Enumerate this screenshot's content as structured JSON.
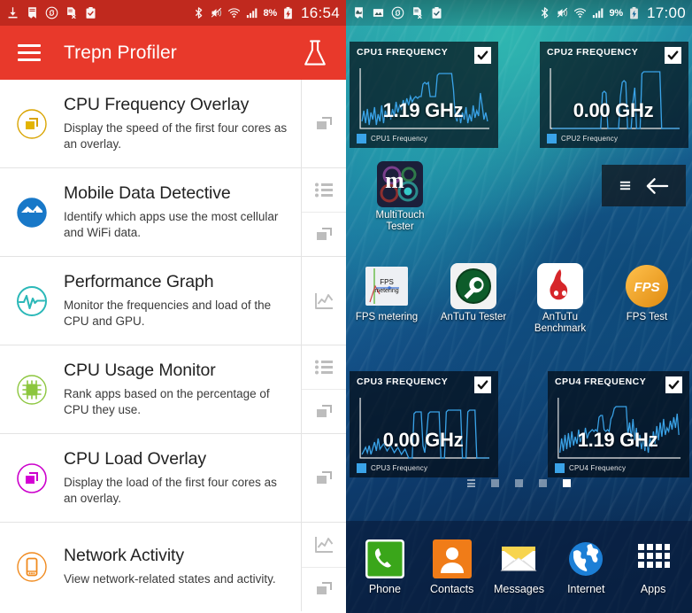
{
  "left_panel": {
    "status_bar": {
      "left_icons": [
        "download-icon",
        "notes-icon",
        "shazam-icon",
        "document-x-icon",
        "clipboard-check-icon"
      ],
      "right_icons": [
        "bluetooth-icon",
        "vibrate-mute-icon",
        "wifi-icon",
        "signal-bars-icon"
      ],
      "battery_percent": "8%",
      "battery_state": "charging",
      "clock": "16:54"
    },
    "appbar": {
      "menu_icon": "hamburger-icon",
      "title": "Trepn Profiler",
      "action_icon": "flask-icon"
    },
    "items": [
      {
        "title": "CPU Frequency Overlay",
        "description": "Display the speed of the first four cores as an overlay.",
        "icon": "overlay-window-icon",
        "icon_color": "#d9a400",
        "actions": [
          "overlay-action-icon"
        ]
      },
      {
        "title": "Mobile Data Detective",
        "description": "Identify which apps use the most cellular and WiFi data.",
        "icon": "data-chart-icon",
        "icon_color": "#1878c8",
        "actions": [
          "list-action-icon",
          "overlay-action-icon"
        ]
      },
      {
        "title": "Performance Graph",
        "description": "Monitor the frequencies and load of the CPU and GPU.",
        "icon": "pulse-icon",
        "icon_color": "#2bb8b8",
        "actions": [
          "graph-action-icon"
        ]
      },
      {
        "title": "CPU Usage Monitor",
        "description": "Rank apps based on the percentage of CPU they use.",
        "icon": "cpu-chip-icon",
        "icon_color": "#8cc63e",
        "actions": [
          "list-action-icon",
          "overlay-action-icon"
        ]
      },
      {
        "title": "CPU Load Overlay",
        "description": "Display the load of the first four cores as an overlay.",
        "icon": "overlay-window-icon",
        "icon_color": "#cc00cc",
        "actions": [
          "overlay-action-icon"
        ]
      },
      {
        "title": "Network Activity",
        "description": "View network-related states and activity.",
        "icon": "phone-network-icon",
        "icon_color": "#f08a1e",
        "actions": [
          "graph-action-icon",
          "overlay-action-icon"
        ]
      }
    ]
  },
  "right_panel": {
    "status_bar": {
      "left_icons": [
        "notes-icon",
        "image-icon",
        "shazam-icon",
        "document-x-icon",
        "clipboard-check-icon"
      ],
      "right_icons": [
        "bluetooth-icon",
        "vibrate-mute-icon",
        "wifi-icon",
        "signal-bars-icon"
      ],
      "battery_percent": "9%",
      "battery_state": "charging",
      "clock": "17:00"
    },
    "widgets": [
      {
        "title": "CPU1 FREQUENCY",
        "value": "1.19 GHz",
        "legend": "CPU1 Frequency",
        "checked": true,
        "series_color": "#3aa3e8"
      },
      {
        "title": "CPU2 FREQUENCY",
        "value": "0.00 GHz",
        "legend": "CPU2 Frequency",
        "checked": true,
        "series_color": "#3aa3e8"
      },
      {
        "title": "CPU3 FREQUENCY",
        "value": "0.00 GHz",
        "legend": "CPU3 Frequency",
        "checked": true,
        "series_color": "#3aa3e8"
      },
      {
        "title": "CPU4 FREQUENCY",
        "value": "1.19 GHz",
        "legend": "CPU4 Frequency",
        "checked": true,
        "series_color": "#3aa3e8"
      }
    ],
    "nav_overlay": {
      "menu_icon": "menu-lines-icon",
      "back_icon": "back-arrow-icon"
    },
    "app_icons": [
      {
        "label": "MultiTouch Tester",
        "icon": "multitouch-tester-icon"
      },
      {
        "label": "FPS metering",
        "icon": "fps-metering-icon"
      },
      {
        "label": "AnTuTu Tester",
        "icon": "antutu-tester-icon"
      },
      {
        "label": "AnTuTu Benchmark",
        "icon": "antutu-benchmark-icon"
      },
      {
        "label": "FPS Test",
        "icon": "fps-test-icon"
      }
    ],
    "page_dots": {
      "count": 5,
      "active_index": 4
    },
    "dock": [
      {
        "label": "Phone",
        "icon": "phone-icon",
        "color": "#3aa61a"
      },
      {
        "label": "Contacts",
        "icon": "contacts-icon",
        "color": "#f07c18"
      },
      {
        "label": "Messages",
        "icon": "messages-icon",
        "color": "#f5c518"
      },
      {
        "label": "Internet",
        "icon": "globe-icon",
        "color": "#1c7fd6"
      },
      {
        "label": "Apps",
        "icon": "apps-grid-icon",
        "color": "#ffffff"
      }
    ]
  }
}
